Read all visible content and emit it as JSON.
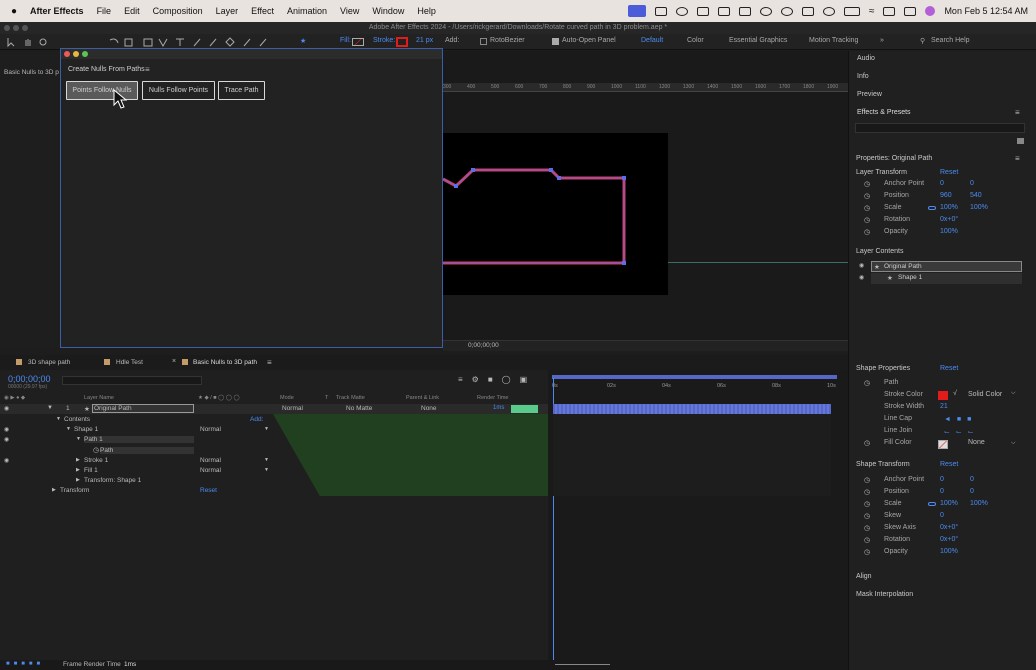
{
  "menubar": {
    "app": "After Effects",
    "items": [
      "File",
      "Edit",
      "Composition",
      "Layer",
      "Effect",
      "Animation",
      "View",
      "Window",
      "Help"
    ],
    "clock": "Mon Feb 5  12:54 AM"
  },
  "window_title": "Adobe After Effects 2024 - /Users/rickgerard/Downloads/Rotate curved path in 3D problem.aep *",
  "toolbar": {
    "fill_label": "Fill:",
    "stroke_label": "Stroke:",
    "stroke_width": "21 px",
    "add_label": "Add:",
    "rotobezier": "RotoBezier",
    "auto_open": "Auto-Open Panel",
    "workspaces": [
      "Default",
      "Color",
      "Essential Graphics",
      "Motion Tracking"
    ],
    "search_placeholder": "Search Help"
  },
  "dialog": {
    "title": "Create Nulls From Paths",
    "buttons": [
      "Points Follow Nulls",
      "Nulls Follow Points",
      "Trace Path"
    ]
  },
  "project_panel_label": "Basic Nulls to 3D p",
  "comp_timecode": "0;00;00;00",
  "ruler_ticks": [
    "300",
    "400",
    "500",
    "600",
    "700",
    "800",
    "900",
    "1000",
    "1100",
    "1200",
    "1300",
    "1400",
    "1500",
    "1600",
    "1700",
    "1800",
    "1900"
  ],
  "right_panel": {
    "sections": [
      "Audio",
      "Info",
      "Preview",
      "Effects & Presets"
    ],
    "properties_title": "Properties: Original Path",
    "layer_transform": "Layer Transform",
    "reset": "Reset",
    "transform_rows": [
      {
        "label": "Anchor Point",
        "v1": "0",
        "v2": "0"
      },
      {
        "label": "Position",
        "v1": "960",
        "v2": "540"
      },
      {
        "label": "Scale",
        "v1": "100%",
        "v2": "100%"
      },
      {
        "label": "Rotation",
        "v1": "0x+0°",
        "v2": ""
      },
      {
        "label": "Opacity",
        "v1": "100%",
        "v2": ""
      }
    ],
    "layer_contents": "Layer Contents",
    "contents_items": [
      "Original Path",
      "Shape 1"
    ],
    "shape_properties": "Shape Properties",
    "shape_rows": [
      {
        "label": "Path",
        "value": ""
      },
      {
        "label": "Stroke Color",
        "value": "Solid Color"
      },
      {
        "label": "Stroke Width",
        "value": "21"
      },
      {
        "label": "Line Cap",
        "value": ""
      },
      {
        "label": "Line Join",
        "value": ""
      },
      {
        "label": "Fill Color",
        "value": "None"
      }
    ],
    "shape_transform": "Shape Transform",
    "shape_transform_rows": [
      {
        "label": "Anchor Point",
        "v1": "0",
        "v2": "0"
      },
      {
        "label": "Position",
        "v1": "0",
        "v2": "0"
      },
      {
        "label": "Scale",
        "v1": "100%",
        "v2": "100%"
      },
      {
        "label": "Skew",
        "v1": "0",
        "v2": ""
      },
      {
        "label": "Skew Axis",
        "v1": "0x+0°",
        "v2": ""
      },
      {
        "label": "Rotation",
        "v1": "0x+0°",
        "v2": ""
      },
      {
        "label": "Opacity",
        "v1": "100%",
        "v2": ""
      }
    ],
    "footer": [
      "Align",
      "Mask Interpolation"
    ]
  },
  "timeline": {
    "tabs": [
      "3D shape path",
      "Hdle Test",
      "Basic Nulls  to 3D path"
    ],
    "timecode": "0;00;00;00",
    "fps": "00000 (29.97 fps)",
    "columns": [
      "Layer Name",
      "Mode",
      "T",
      "Track Matte",
      "Parent & Link",
      "Render Time"
    ],
    "ruler": [
      "0s",
      "02s",
      "04s",
      "06s",
      "08s",
      "10s"
    ],
    "layer_num": "1",
    "layer_name": "Original Path",
    "layer_mode": "Normal",
    "layer_matte": "No Matte",
    "layer_parent": "None",
    "render_time": "1ms",
    "rows": [
      {
        "name": "Contents",
        "right": "Add:"
      },
      {
        "name": "Shape 1",
        "right": "Normal"
      },
      {
        "name": "Path 1",
        "right": ""
      },
      {
        "name": "Path",
        "right": ""
      },
      {
        "name": "Stroke 1",
        "right": "Normal"
      },
      {
        "name": "Fill 1",
        "right": "Normal"
      },
      {
        "name": "Transform: Shape 1",
        "right": ""
      },
      {
        "name": "Transform",
        "right": "Reset"
      }
    ],
    "status": "Frame Render Time",
    "status_value": "1ms"
  },
  "colors": {
    "accent": "#4c8cf0",
    "path_red": "#e2364f",
    "stroke_swatch": "#e21b1b",
    "layer_bar": "#5567c9",
    "render_bar": "#59cc8c"
  }
}
